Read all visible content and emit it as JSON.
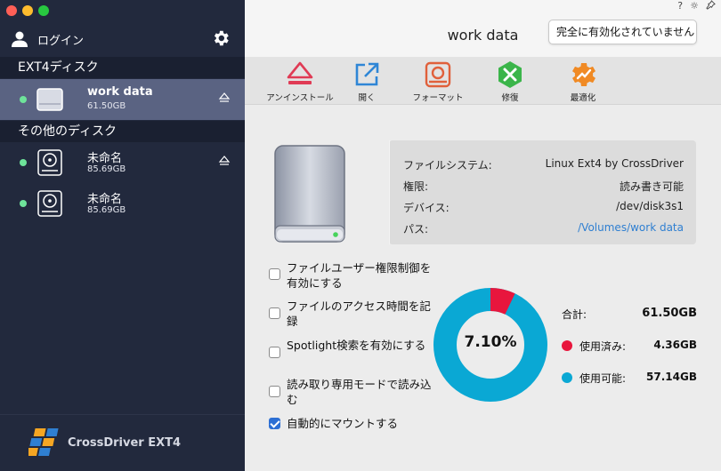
{
  "sidebar": {
    "user_label": "ログイン",
    "section_ext4": "EXT4ディスク",
    "section_other": "その他のディスク",
    "disks": [
      {
        "name": "work data",
        "size": "61.50GB"
      },
      {
        "name": "未命名",
        "size": "85.69GB"
      },
      {
        "name": "未命名",
        "size": "85.69GB"
      }
    ],
    "brand": "CrossDriver EXT4"
  },
  "header": {
    "title": "work data",
    "notice": "完全に有効化されていません",
    "help_icon": "?",
    "brightness_icon": "☼",
    "pin_icon": "📌"
  },
  "toolbar": {
    "uninstall": "アンインストール",
    "open": "開く",
    "format": "フォーマット",
    "repair": "修復",
    "optimize": "最適化"
  },
  "info": {
    "fs_label": "ファイルシステム:",
    "fs_value": "Linux Ext4 by CrossDriver",
    "perm_label": "権限:",
    "perm_value": "読み書き可能",
    "device_label": "デバイス:",
    "device_value": "/dev/disk3s1",
    "path_label": "パス:",
    "path_value": "/Volumes/work data"
  },
  "options": [
    {
      "label": "ファイルユーザー権限制御を有効にする",
      "checked": false
    },
    {
      "label": "ファイルのアクセス時間を記録",
      "checked": false
    },
    {
      "label": "Spotlight検索を有効にする",
      "checked": false
    },
    {
      "label": "読み取り専用モードで読み込む",
      "checked": false
    },
    {
      "label": "自動的にマウントする",
      "checked": true
    }
  ],
  "usage": {
    "percent_label": "7.10%",
    "used_fraction": 0.071,
    "total_label": "合計:",
    "total_value": "61.50GB",
    "used_label": "使用済み:",
    "used_value": "4.36GB",
    "free_label": "使用可能:",
    "free_value": "57.14GB"
  },
  "colors": {
    "used": "#e8163d",
    "free": "#0aa8d4",
    "accent": "#2d6fd4",
    "online": "#6ee39a"
  }
}
